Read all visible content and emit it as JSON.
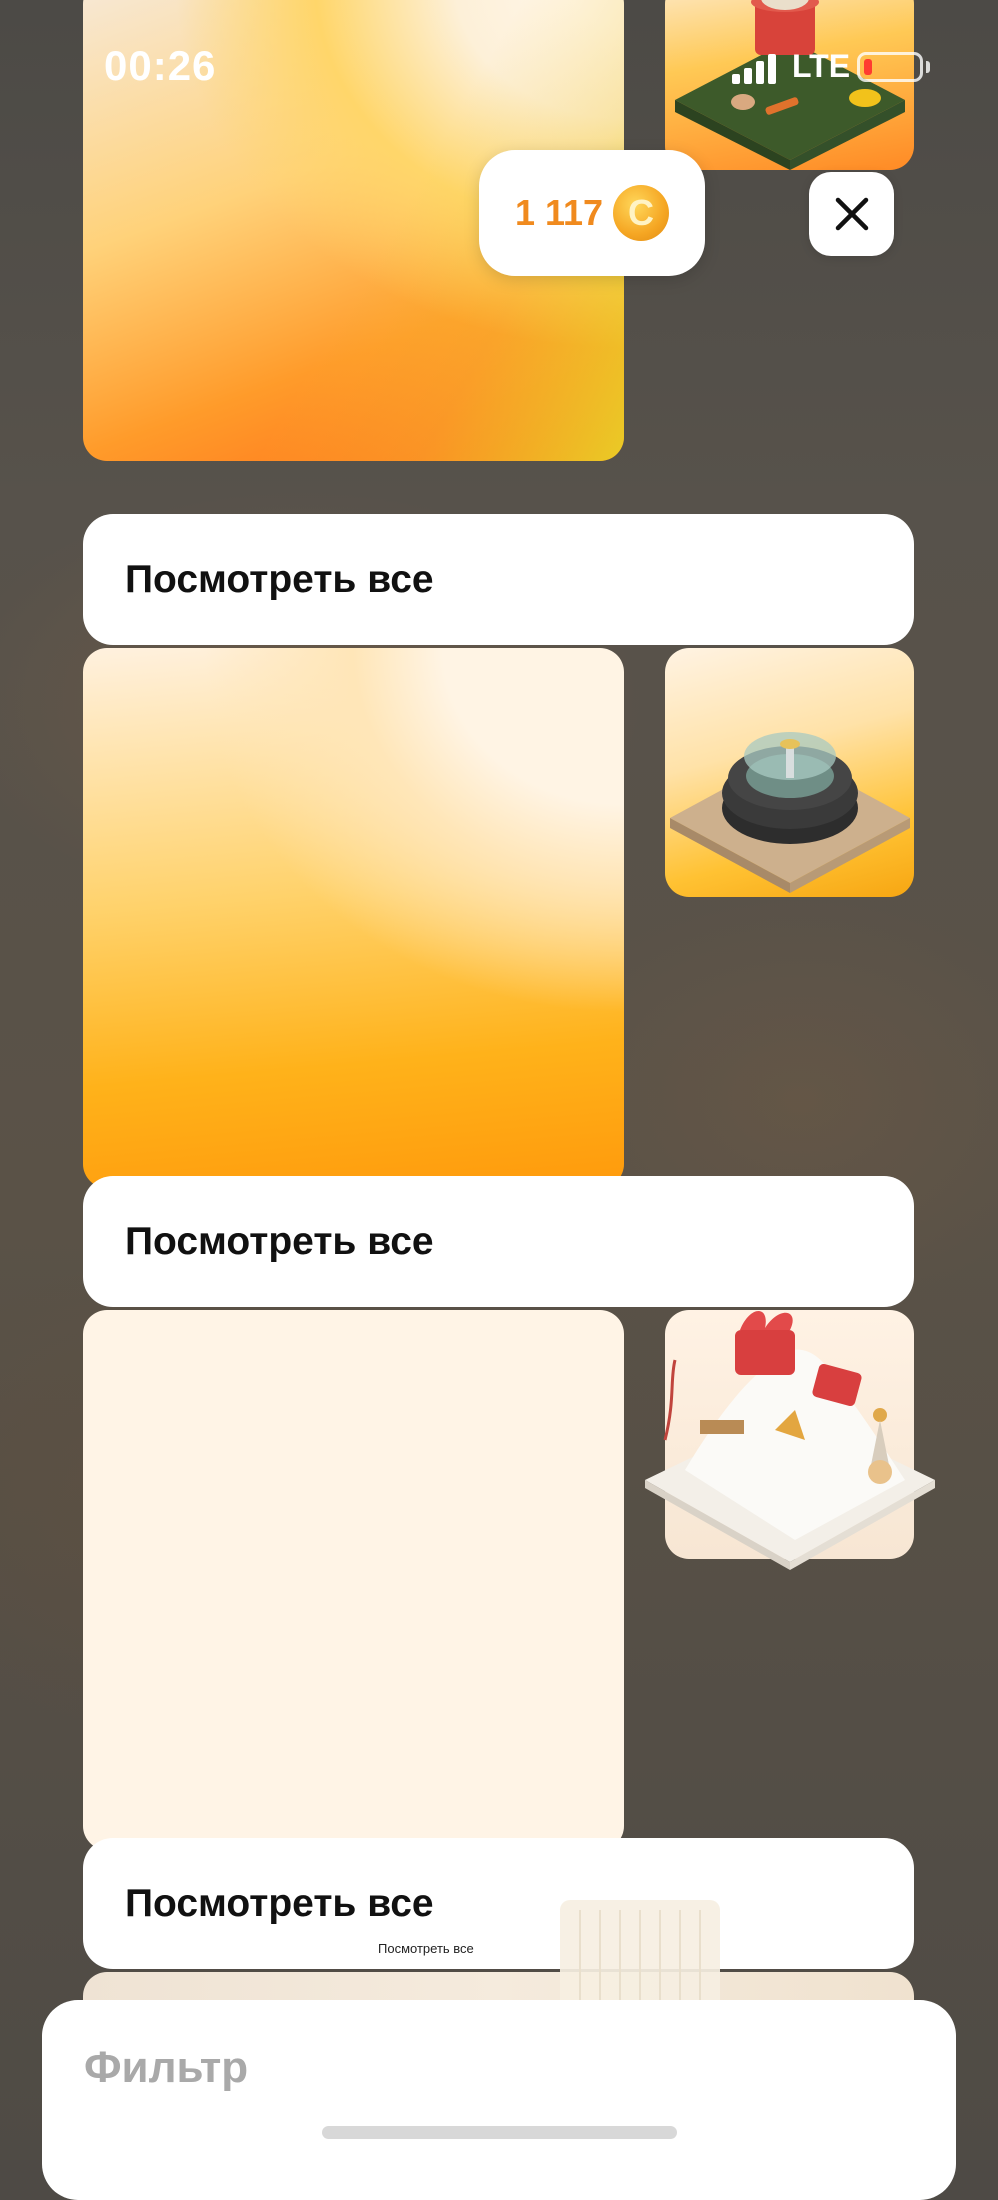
{
  "status_bar": {
    "time": "00:26",
    "network": "LTE",
    "battery_color": "#ff3b30"
  },
  "wallet": {
    "coins": "1 117",
    "coin_symbol": "C",
    "coin_color": "#f5a623"
  },
  "close_icon": "close-icon",
  "sections": [
    {
      "view_all_label": "Посмотреть все"
    },
    {
      "view_all_label": "Посмотреть все"
    },
    {
      "view_all_label": "Посмотреть все"
    }
  ],
  "overlay_tiny_label": "Посмотреть все",
  "bottom_sheet": {
    "title": "Фильтр"
  }
}
